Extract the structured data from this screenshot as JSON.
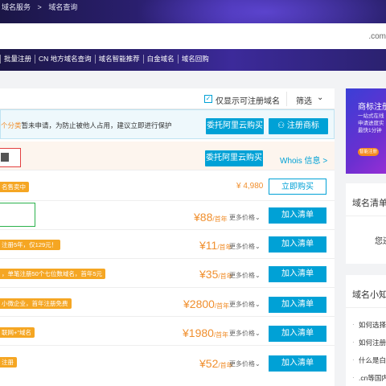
{
  "breadcrumb": {
    "items": [
      "域名服务",
      ">",
      "域名查询"
    ]
  },
  "search": {
    "suffix": ".com"
  },
  "nav": {
    "items": [
      "批量注册",
      "CN 地方域名查询",
      "域名智能推荐",
      "白金域名",
      "域名回购"
    ]
  },
  "filter": {
    "checkbox_label": "仅显示可注册域名",
    "filter_label": "筛选",
    "checked": true
  },
  "banner": {
    "text_highlight": "个分类",
    "text": "暂未申请，为防止被他人占用，建议立即进行保护",
    "entrust_label": "委托阿里云购买",
    "trademark_label": "注册商标"
  },
  "status_row": {
    "entrust_label": "委托阿里云购买",
    "whois_label": "Whois 信息 >"
  },
  "rows": [
    {
      "tag": "名售卖中",
      "price": "¥ 4,980",
      "unit": "",
      "more": "",
      "button": "立即购买",
      "type": "buy"
    },
    {
      "tag": "",
      "price": "¥88",
      "unit": "/首年",
      "more": "更多价格",
      "button": "加入清单",
      "type": "add"
    },
    {
      "tag": "注册5年，仅129元！",
      "price": "¥11",
      "unit": "/首年",
      "more": "更多价格",
      "button": "加入清单",
      "type": "add"
    },
    {
      "tag": "，单笔注册50个七位数域名，首年5元",
      "price": "¥35",
      "unit": "/首年",
      "more": "更多价格",
      "button": "加入清单",
      "type": "add"
    },
    {
      "tag": "小微企业，首年注册免费",
      "price": "¥2800",
      "unit": "/首年",
      "more": "更多价格",
      "button": "加入清单",
      "type": "add"
    },
    {
      "tag": "联网+\"域名",
      "price": "¥1980",
      "unit": "/首年",
      "more": "更多价格",
      "button": "加入清单",
      "type": "add"
    },
    {
      "tag": "注册",
      "price": "¥52",
      "unit": "/首年",
      "more": "更多价格",
      "button": "加入清单",
      "type": "add"
    }
  ],
  "side_ad": {
    "title": "商标注册",
    "sub1": "一站式在线",
    "sub2": "申请进度实",
    "sub3": "最快1分钟",
    "pill": "智能注册"
  },
  "side_list": {
    "title": "域名清单",
    "empty": "您还"
  },
  "side_faq": {
    "title": "域名小知",
    "items": [
      "如何选择",
      "如何注册",
      "什么是白",
      ".cn等国内"
    ]
  }
}
